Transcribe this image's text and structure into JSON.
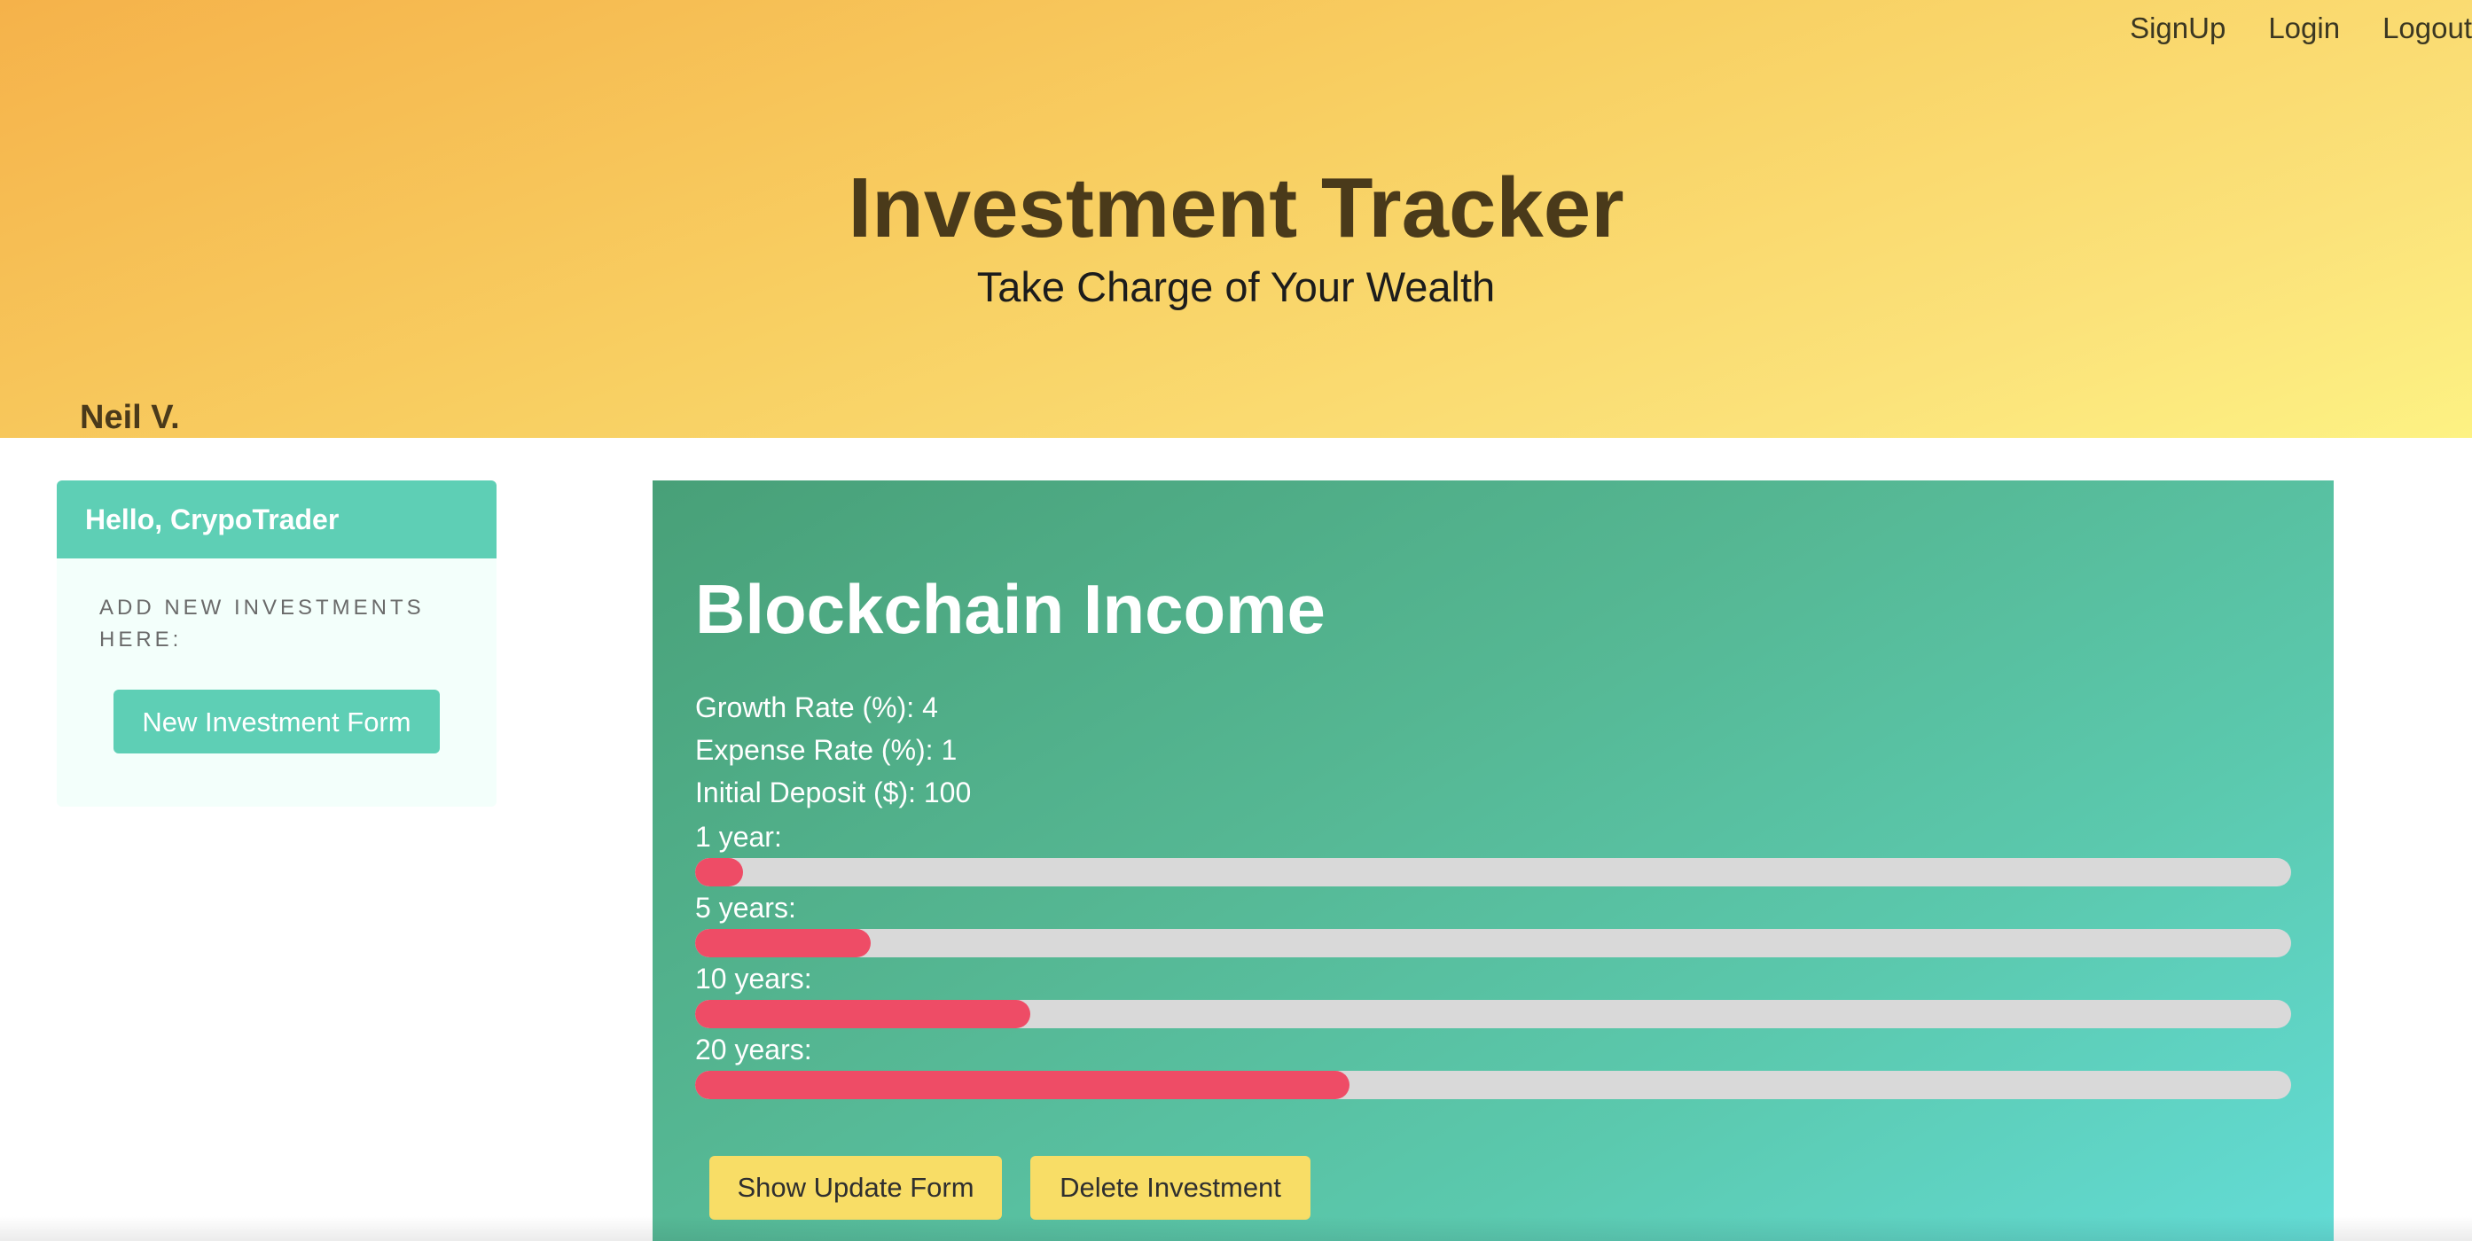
{
  "nav": {
    "items": [
      "SignUp",
      "Login",
      "Logout"
    ]
  },
  "hero": {
    "title": "Investment Tracker",
    "subtitle": "Take Charge of Your Wealth",
    "user_name": "Neil V."
  },
  "sidebar": {
    "greeting": "Hello, CrypoTrader",
    "caption": "ADD NEW INVESTMENTS HERE:",
    "new_form_label": "New Investment Form"
  },
  "investment": {
    "title": "Blockchain Income",
    "growth_rate": "Growth Rate (%): 4",
    "expense_rate": "Expense Rate (%): 1",
    "initial_deposit": "Initial Deposit ($): 100",
    "projections": [
      {
        "label": "1 year:",
        "fraction": 0.03
      },
      {
        "label": "5 years:",
        "fraction": 0.11
      },
      {
        "label": "10 years:",
        "fraction": 0.21
      },
      {
        "label": "20 years:",
        "fraction": 0.41
      }
    ],
    "update_label": "Show Update Form",
    "delete_label": "Delete Investment"
  },
  "colors": {
    "hero_start": "#f5b24a",
    "hero_end": "#fdf283",
    "accent_teal": "#5ecfb5",
    "card_start": "#48a078",
    "card_end": "#63dcd6",
    "progress_fill": "#ee4c66",
    "progress_track": "#d9d9d9",
    "button_yellow": "#f8dd66"
  }
}
